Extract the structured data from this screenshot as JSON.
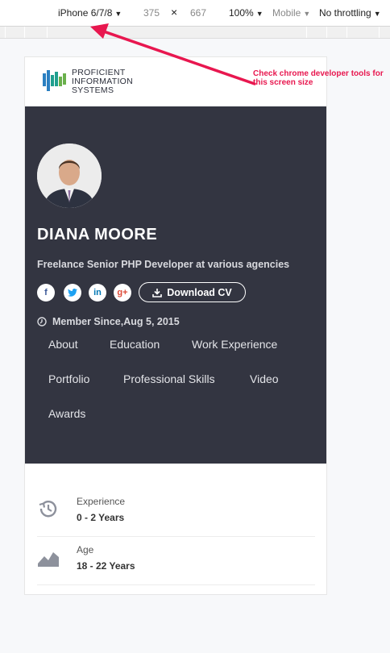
{
  "devtools": {
    "device": "iPhone 6/7/8",
    "width": "375",
    "times": "×",
    "height": "667",
    "zoom": "100%",
    "mode": "Mobile",
    "throttle": "No throttling"
  },
  "annotation": {
    "text": "Check chrome developer tools for this screen size",
    "color": "#e8174f"
  },
  "brand": {
    "line1": "PROFICIENT",
    "line2": "INFORMATION",
    "line3": "SYSTEMS",
    "colors": [
      "#2a7fc1",
      "#1f9f8e",
      "#6ab04c"
    ]
  },
  "profile": {
    "name": "DIANA MOORE",
    "role": "Freelance Senior PHP Developer at various agencies",
    "social": [
      {
        "icon": "facebook-icon",
        "glyph": "f",
        "color": "#3b5998"
      },
      {
        "icon": "twitter-icon",
        "glyph": "t",
        "color": "#1da1f2"
      },
      {
        "icon": "linkedin-icon",
        "glyph": "in",
        "color": "#0077b5"
      },
      {
        "icon": "google-plus-icon",
        "glyph": "g+",
        "color": "#dd4b39"
      }
    ],
    "download_label": "Download CV",
    "member_since": "Member Since,Aug 5, 2015",
    "nav": [
      "About",
      "Education",
      "Work Experience",
      "Portfolio",
      "Professional Skills",
      "Video",
      "Awards"
    ],
    "background": "#333541"
  },
  "stats": [
    {
      "label": "Experience",
      "value": "0 - 2 Years",
      "icon": "history-icon"
    },
    {
      "label": "Age",
      "value": "18 - 22 Years",
      "icon": "area-chart-icon"
    }
  ]
}
